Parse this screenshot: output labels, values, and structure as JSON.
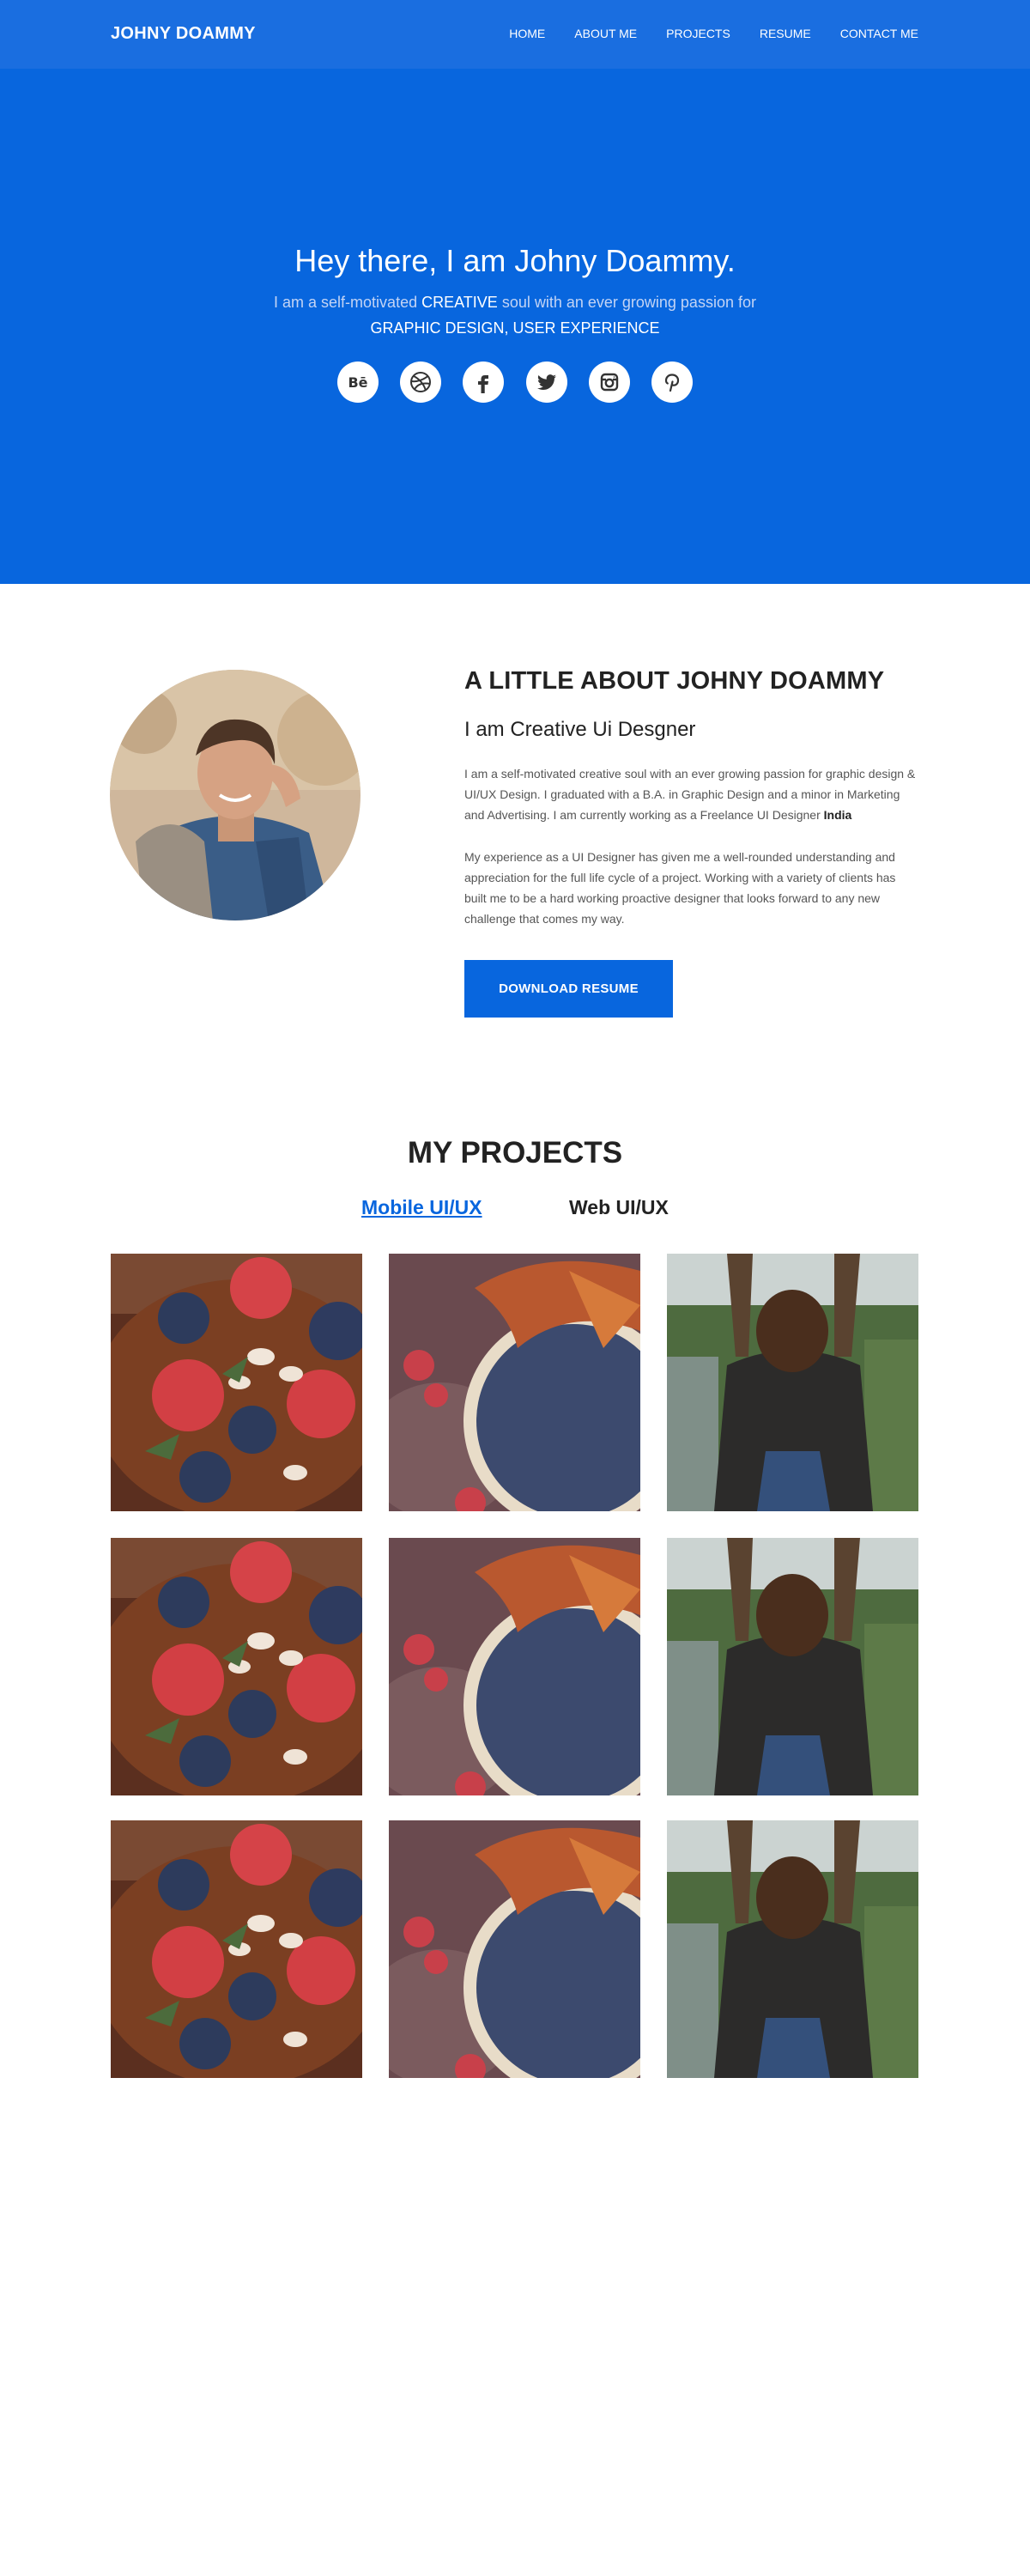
{
  "header": {
    "brand": "JOHNY DOAMMY",
    "nav": [
      "HOME",
      "ABOUT ME",
      "PROJECTS",
      "RESUME",
      "CONTACT ME"
    ]
  },
  "hero": {
    "title": "Hey there, I am Johny Doammy.",
    "line1_pre": "I am a self-motivated",
    "line1_em": "CREATIVE",
    "line1_post": "soul with an ever growing passion for",
    "line2": "GRAPHIC DESIGN, USER EXPERIENCE",
    "socials": [
      "behance-icon",
      "dribbble-icon",
      "facebook-icon",
      "twitter-icon",
      "instagram-icon",
      "pinterest-icon"
    ]
  },
  "about": {
    "heading": "A LITTLE ABOUT JOHNY DOAMMY",
    "subheading": "I am Creative Ui Desgner",
    "p1_text": "I am a self-motivated creative soul with an ever growing passion for graphic design & UI/UX Design. I graduated with a B.A. in Graphic Design and a minor in Marketing and Advertising. I am currently working as a Freelance UI Designer",
    "p1_bold": "India",
    "p2": "My experience as a UI Designer has given me a well-rounded understanding and appreciation for the full life cycle of a project. Working with a variety of clients has built me to be a hard working proactive designer that looks forward to any new challenge that comes my way.",
    "button": "DOWNLOAD RESUME"
  },
  "projects": {
    "heading": "MY PROJECTS",
    "tabs": [
      "Mobile UI/UX",
      "Web UI/UX"
    ]
  },
  "colors": {
    "header_bg": "#1a6ee0",
    "hero_bg": "#0866de",
    "accent": "#0866de",
    "text_dark": "#222222"
  }
}
